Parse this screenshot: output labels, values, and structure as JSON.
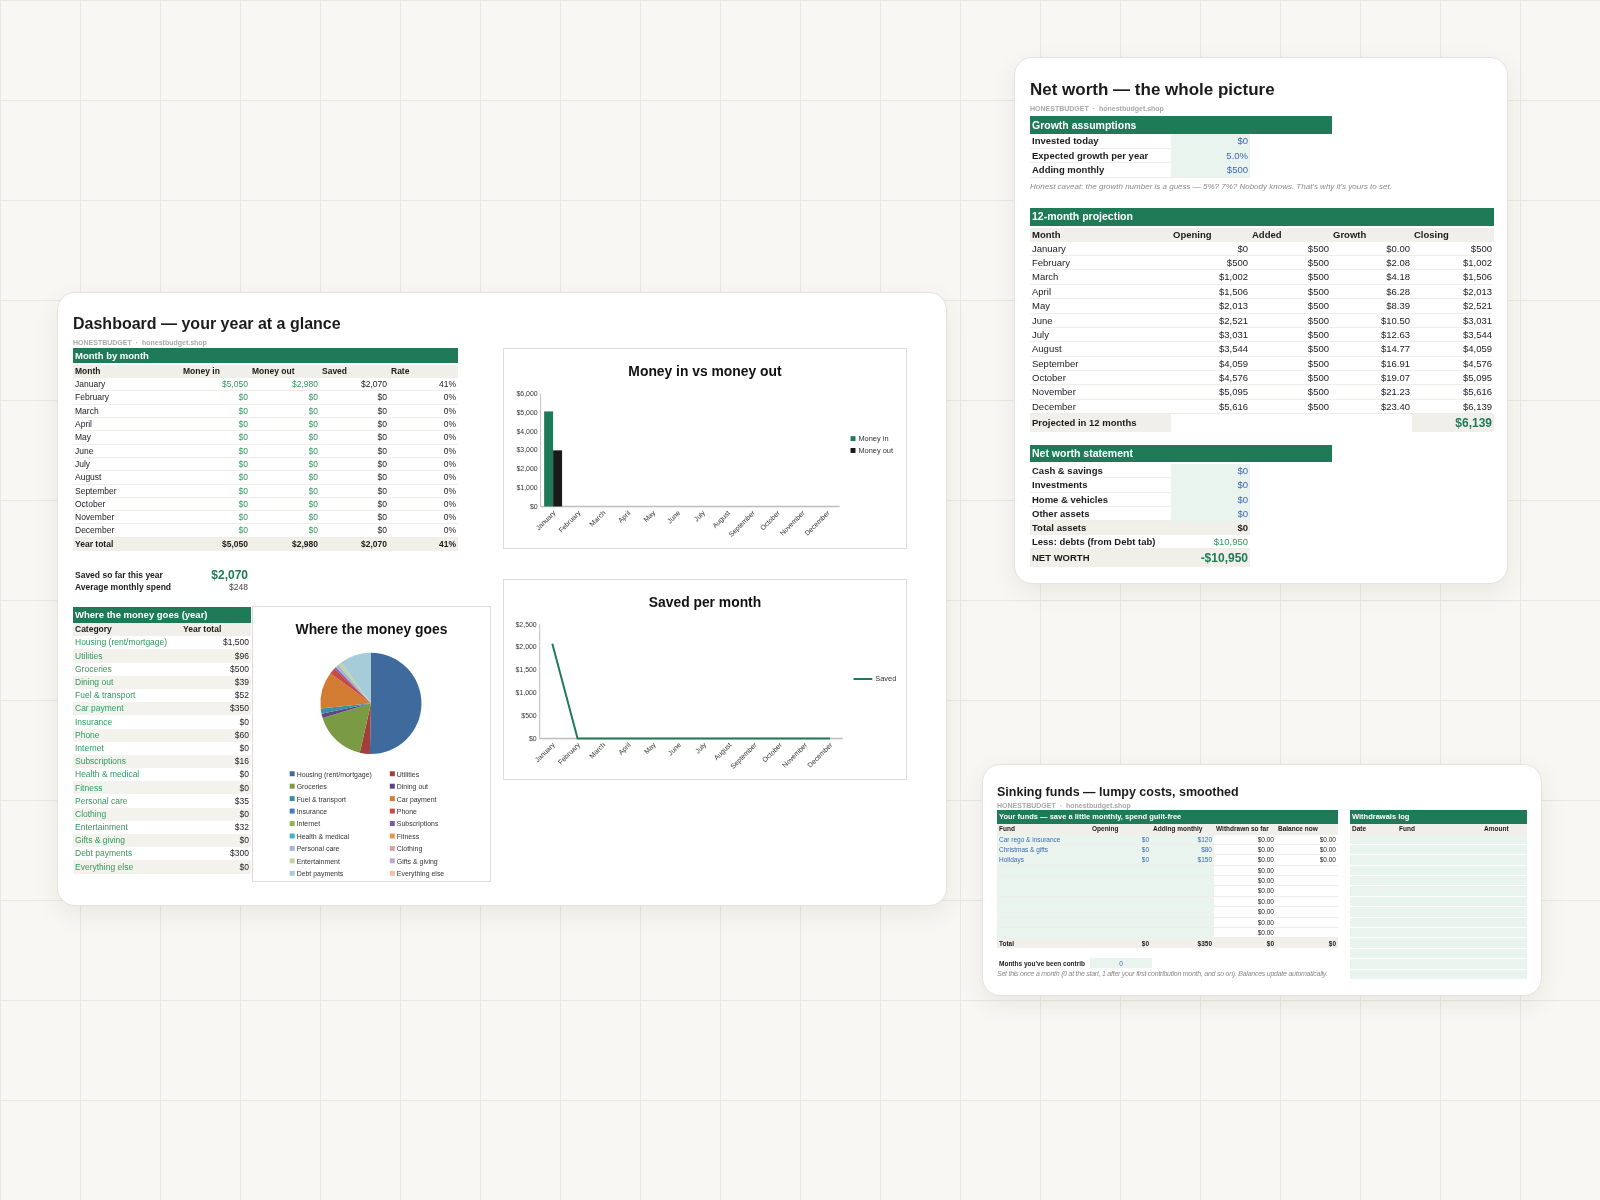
{
  "dashboard": {
    "title": "Dashboard — your year at a glance",
    "byline": "HONESTBUDGET · honestbudget.shop",
    "months": {
      "header": "Month by month",
      "columns": [
        "Month",
        "Money in",
        "Money out",
        "Saved",
        "Rate"
      ],
      "rows": [
        [
          "January",
          "$5,050",
          "$2,980",
          "$2,070",
          "41%"
        ],
        [
          "February",
          "$0",
          "$0",
          "$0",
          "0%"
        ],
        [
          "March",
          "$0",
          "$0",
          "$0",
          "0%"
        ],
        [
          "April",
          "$0",
          "$0",
          "$0",
          "0%"
        ],
        [
          "May",
          "$0",
          "$0",
          "$0",
          "0%"
        ],
        [
          "June",
          "$0",
          "$0",
          "$0",
          "0%"
        ],
        [
          "July",
          "$0",
          "$0",
          "$0",
          "0%"
        ],
        [
          "August",
          "$0",
          "$0",
          "$0",
          "0%"
        ],
        [
          "September",
          "$0",
          "$0",
          "$0",
          "0%"
        ],
        [
          "October",
          "$0",
          "$0",
          "$0",
          "0%"
        ],
        [
          "November",
          "$0",
          "$0",
          "$0",
          "0%"
        ],
        [
          "December",
          "$0",
          "$0",
          "$0",
          "0%"
        ]
      ],
      "total": [
        "Year total",
        "$5,050",
        "$2,980",
        "$2,070",
        "41%"
      ]
    },
    "summary": [
      {
        "label": "Saved so far this year",
        "value": "$2,070",
        "kind": "highlight"
      },
      {
        "label": "Average monthly spend",
        "value": "$248",
        "kind": "plain"
      }
    ],
    "spending": {
      "header": "Where the money goes (year)",
      "columns": [
        "Category",
        "Year total"
      ],
      "rows": [
        {
          "category": "Housing (rent/mortgage)",
          "total": "$1,500"
        },
        {
          "category": "Utilities",
          "total": "$96"
        },
        {
          "category": "Groceries",
          "total": "$500"
        },
        {
          "category": "Dining out",
          "total": "$39"
        },
        {
          "category": "Fuel & transport",
          "total": "$52"
        },
        {
          "category": "Car payment",
          "total": "$350"
        },
        {
          "category": "Insurance",
          "total": "$0"
        },
        {
          "category": "Phone",
          "total": "$60"
        },
        {
          "category": "Internet",
          "total": "$0"
        },
        {
          "category": "Subscriptions",
          "total": "$16"
        },
        {
          "category": "Health & medical",
          "total": "$0"
        },
        {
          "category": "Fitness",
          "total": "$0"
        },
        {
          "category": "Personal care",
          "total": "$35"
        },
        {
          "category": "Clothing",
          "total": "$0"
        },
        {
          "category": "Entertainment",
          "total": "$32"
        },
        {
          "category": "Gifts & giving",
          "total": "$0"
        },
        {
          "category": "Debt payments",
          "total": "$300"
        },
        {
          "category": "Everything else",
          "total": "$0"
        }
      ],
      "chart_data": {
        "type": "pie",
        "title": "Where the money goes",
        "categories": [
          "Housing (rent/mortgage)",
          "Utilities",
          "Groceries",
          "Dining out",
          "Fuel & transport",
          "Car payment",
          "Insurance",
          "Phone",
          "Internet",
          "Subscriptions",
          "Health & medical",
          "Fitness",
          "Personal care",
          "Clothing",
          "Entertainment",
          "Gifts & giving",
          "Debt payments",
          "Everything else"
        ],
        "values": [
          50.35,
          3.22,
          16.78,
          1.31,
          1.74,
          11.74,
          0,
          2.01,
          0,
          0.54,
          0,
          0,
          1.17,
          0,
          1.07,
          0,
          10.07,
          0
        ],
        "legend": "bottom",
        "colors": [
          "#3e6a9e",
          "#a33f3b",
          "#7a9a44",
          "#5d4585",
          "#3592a6",
          "#d27b33",
          "#4a78b8",
          "#c74a47",
          "#93b24f",
          "#7c58a6",
          "#3eb0c8",
          "#f0924a",
          "#a4b6d8",
          "#d6a3a1",
          "#c3d3a0",
          "#b8aacc",
          "#a6cbd9",
          "#f3c0a6"
        ]
      }
    },
    "in_vs_out": {
      "chart_data": {
        "type": "bar",
        "title": "Money in vs money out",
        "categories": [
          "January",
          "February",
          "March",
          "April",
          "May",
          "June",
          "July",
          "August",
          "September",
          "October",
          "November",
          "December"
        ],
        "series": [
          {
            "name": "Money in",
            "color": "#1f7a58",
            "values": [
              5050,
              0,
              0,
              0,
              0,
              0,
              0,
              0,
              0,
              0,
              0,
              0
            ]
          },
          {
            "name": "Money out",
            "color": "#1a1a1a",
            "values": [
              2980,
              0,
              0,
              0,
              0,
              0,
              0,
              0,
              0,
              0,
              0,
              0
            ]
          }
        ],
        "legend": "right",
        "ylim": [
          0,
          6000
        ],
        "yticks": [
          {
            "value": 0,
            "label": "$0"
          },
          {
            "value": 1000,
            "label": "$1,000"
          },
          {
            "value": 2000,
            "label": "$2,000"
          },
          {
            "value": 3000,
            "label": "$3,000"
          },
          {
            "value": 4000,
            "label": "$4,000"
          },
          {
            "value": 5000,
            "label": "$5,000"
          },
          {
            "value": 6000,
            "label": "$6,000"
          }
        ]
      }
    },
    "saved_per_month": {
      "chart_data": {
        "type": "line",
        "title": "Saved per month",
        "categories": [
          "January",
          "February",
          "March",
          "April",
          "May",
          "June",
          "July",
          "August",
          "September",
          "October",
          "November",
          "December"
        ],
        "series": [
          {
            "name": "Saved",
            "color": "#1f7a58",
            "values": [
              2070,
              0,
              0,
              0,
              0,
              0,
              0,
              0,
              0,
              0,
              0,
              0
            ]
          }
        ],
        "legend": "right",
        "ylim": [
          0,
          2500
        ],
        "yticks": [
          {
            "value": 0,
            "label": "$0"
          },
          {
            "value": 500,
            "label": "$500"
          },
          {
            "value": 1000,
            "label": "$1,000"
          },
          {
            "value": 1500,
            "label": "$1,500"
          },
          {
            "value": 2000,
            "label": "$2,000"
          },
          {
            "value": 2500,
            "label": "$2,500"
          }
        ]
      }
    }
  },
  "net_worth": {
    "title": "Net worth — the whole picture",
    "byline": "HONESTBUDGET · honestbudget.shop",
    "growth": {
      "header": "Growth assumptions",
      "rows": [
        {
          "label": "Invested today",
          "value": "$0"
        },
        {
          "label": "Expected growth per year",
          "value": "5.0%"
        },
        {
          "label": "Adding monthly",
          "value": "$500"
        }
      ],
      "caveat": "Honest caveat: the growth number is a guess — 5%? 7%? Nobody knows. That's why it's yours to set."
    },
    "projection": {
      "header": "12-month projection",
      "columns": [
        "Month",
        "Opening",
        "Added",
        "Growth",
        "Closing"
      ],
      "rows": [
        [
          "January",
          "$0",
          "$500",
          "$0.00",
          "$500"
        ],
        [
          "February",
          "$500",
          "$500",
          "$2.08",
          "$1,002"
        ],
        [
          "March",
          "$1,002",
          "$500",
          "$4.18",
          "$1,506"
        ],
        [
          "April",
          "$1,506",
          "$500",
          "$6.28",
          "$2,013"
        ],
        [
          "May",
          "$2,013",
          "$500",
          "$8.39",
          "$2,521"
        ],
        [
          "June",
          "$2,521",
          "$500",
          "$10.50",
          "$3,031"
        ],
        [
          "July",
          "$3,031",
          "$500",
          "$12.63",
          "$3,544"
        ],
        [
          "August",
          "$3,544",
          "$500",
          "$14.77",
          "$4,059"
        ],
        [
          "September",
          "$4,059",
          "$500",
          "$16.91",
          "$4,576"
        ],
        [
          "October",
          "$4,576",
          "$500",
          "$19.07",
          "$5,095"
        ],
        [
          "November",
          "$5,095",
          "$500",
          "$21.23",
          "$5,616"
        ],
        [
          "December",
          "$5,616",
          "$500",
          "$23.40",
          "$6,139"
        ]
      ],
      "total": {
        "label": "Projected in 12 months",
        "value": "$6,139"
      }
    },
    "statement": {
      "header": "Net worth statement",
      "rows": [
        {
          "label": "Cash & savings",
          "value": "$0",
          "kind": "input"
        },
        {
          "label": "Investments",
          "value": "$0",
          "kind": "input"
        },
        {
          "label": "Home & vehicles",
          "value": "$0",
          "kind": "input"
        },
        {
          "label": "Other assets",
          "value": "$0",
          "kind": "input"
        },
        {
          "label": "Total assets",
          "value": "$0",
          "kind": "total"
        },
        {
          "label": "Less: debts (from Debt tab)",
          "value": "$10,950",
          "kind": "debt"
        },
        {
          "label": "NET WORTH",
          "value": "-$10,950",
          "kind": "net"
        }
      ]
    }
  },
  "sinking_funds": {
    "title": "Sinking funds — lumpy costs, smoothed",
    "byline": "HONESTBUDGET · honestbudget.shop",
    "funds": {
      "header": "Your funds — save a little monthly, spend guilt-free",
      "columns": [
        "Fund",
        "Opening",
        "Adding monthly",
        "Withdrawn so far",
        "Balance now"
      ],
      "rows": [
        {
          "kind": "fund",
          "fund": "Car rego & insurance",
          "opening": "$0",
          "adding": "$120",
          "withdrawn": "$0.00",
          "balance": "$0.00"
        },
        {
          "kind": "fund",
          "fund": "Christmas & gifts",
          "opening": "$0",
          "adding": "$80",
          "withdrawn": "$0.00",
          "balance": "$0.00"
        },
        {
          "kind": "fund",
          "fund": "Holidays",
          "opening": "$0",
          "adding": "$150",
          "withdrawn": "$0.00",
          "balance": "$0.00"
        },
        {
          "kind": "blank",
          "withdrawn": "$0.00"
        },
        {
          "kind": "blank",
          "withdrawn": "$0.00"
        },
        {
          "kind": "blank",
          "withdrawn": "$0.00"
        },
        {
          "kind": "blank",
          "withdrawn": "$0.00"
        },
        {
          "kind": "blank",
          "withdrawn": "$0.00"
        },
        {
          "kind": "blank",
          "withdrawn": "$0.00"
        },
        {
          "kind": "blank",
          "withdrawn": "$0.00"
        }
      ],
      "total": [
        "Total",
        "$0",
        "$350",
        "$0",
        "$0"
      ],
      "months_label": "Months you've been contrib",
      "months_value": "0",
      "note": "Set this once a month (0 at the start, 1 after your first contribution month, and so on). Balances update automatically."
    },
    "log": {
      "header": "Withdrawals log",
      "columns": [
        "Date",
        "Fund",
        "Amount"
      ]
    }
  }
}
